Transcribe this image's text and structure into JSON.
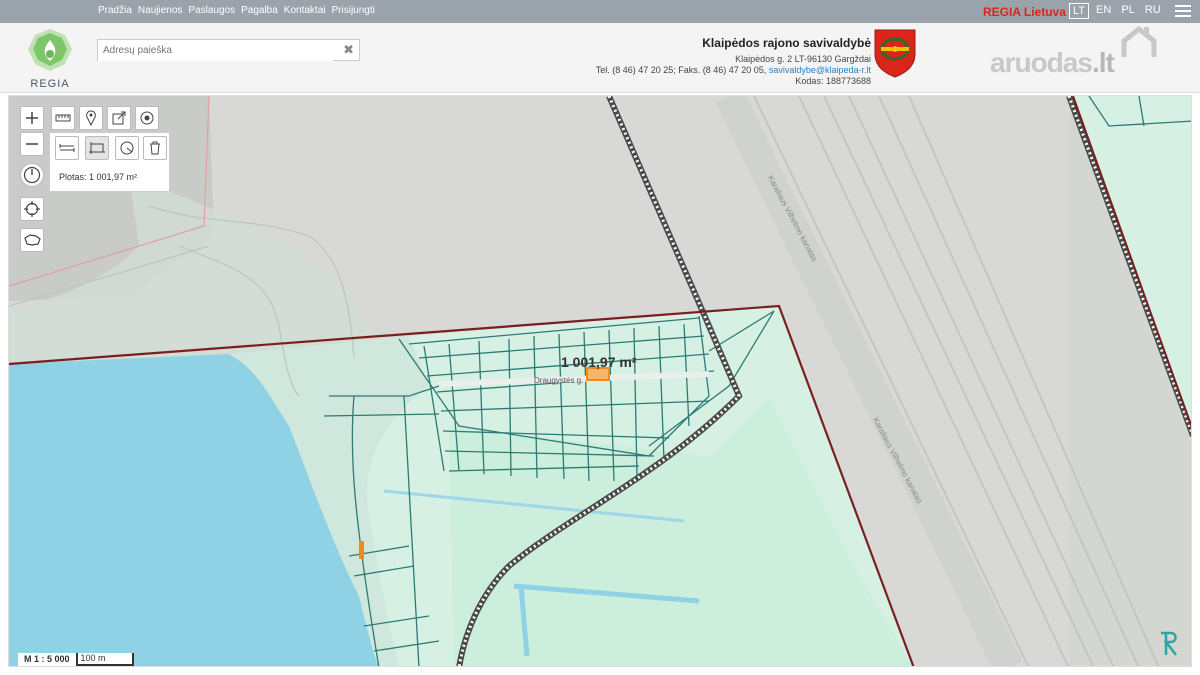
{
  "nav": {
    "items": [
      "Pradžia",
      "Naujienos",
      "Paslaugos",
      "Pagalba",
      "Kontaktai",
      "Prisijungti"
    ],
    "regia_lt": "REGIA Lietuva",
    "languages": [
      "LT",
      "EN",
      "PL",
      "RU"
    ],
    "active_language": "LT"
  },
  "header": {
    "brand": "REGIA",
    "search_placeholder": "Adresų paieška",
    "clear_icon": "close-icon",
    "municipality": {
      "name": "Klaipėdos rajono savivaldybė",
      "address": "Klaipėdos g. 2 LT-96130 Gargždai",
      "phone": "Tel. (8 46) 47 20 25; Faks. (8 46) 47 20 05,",
      "email": "savivaldybe@klaipeda-r.lt",
      "code": "Kodas: 188773688"
    },
    "partner_logo": {
      "word": "aruodas",
      "suffix": ".lt"
    }
  },
  "map": {
    "tools": [
      "zoom-in-icon",
      "zoom-out-icon",
      "measure-ruler-icon",
      "marker-icon",
      "share-icon",
      "target-icon",
      "measure-line-icon",
      "measure-area-icon",
      "measure-radius-icon",
      "trash-icon",
      "compass-icon",
      "locate-icon",
      "lithuania-outline-icon"
    ],
    "area_text": "Plotas: 1 001,97 m²",
    "area_label": "1 001,97 m²",
    "street_label": "Draugystės g.",
    "road_label": "Karaliaus Vilhelmo kanalas",
    "scale_ratio": "M 1 : 5 000",
    "scale_bar": "100 m",
    "colors": {
      "water": "#8fd2e6",
      "parcel_fill": "#d6f1e4",
      "parcel_line": "#2d7a74",
      "boundary": "#7a1f1f",
      "railway": "#4a4a4a",
      "highlight": "#f08a1c"
    }
  }
}
